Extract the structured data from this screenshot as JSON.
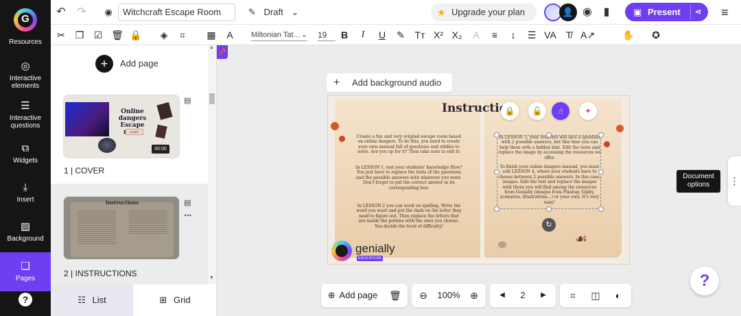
{
  "rail": {
    "logo_letter": "G",
    "items": [
      {
        "label": "Resources",
        "icon": "resources-icon"
      },
      {
        "label": "Interactive elements",
        "icon": "interactive-elements-icon"
      },
      {
        "label": "Interactive questions",
        "icon": "questions-icon"
      },
      {
        "label": "Widgets",
        "icon": "widgets-icon"
      },
      {
        "label": "Insert",
        "icon": "insert-icon"
      },
      {
        "label": "Background",
        "icon": "background-icon"
      },
      {
        "label": "Pages",
        "icon": "pages-icon"
      }
    ],
    "help": "?"
  },
  "topbar": {
    "title": "Witchcraft Escape Room",
    "status": "Draft",
    "upgrade_label": "Upgrade your plan",
    "present_label": "Present"
  },
  "format": {
    "font": "Miltonian Tat…",
    "size": "19",
    "bold": "B",
    "italic": "I",
    "underline": "U"
  },
  "pages": {
    "add_label": "Add page",
    "items": [
      {
        "number": "1",
        "name": "COVER",
        "thumb_title": "Online dangers Escape room",
        "thumb_button": "START",
        "thumb_timer": "00:00"
      },
      {
        "number": "2",
        "name": "INSTRUCTIONS",
        "thumb_title": "Instructions"
      }
    ],
    "view": {
      "list": "List",
      "grid": "Grid"
    }
  },
  "canvas": {
    "bg_audio_label": "Add background audio",
    "slide": {
      "title": "Instructio",
      "left_p1": "Create a fun and very original escape room based on online dangers. To do this, you need to create your own manual full of questions and riddles to solve. Are you up for it? Then take note to edit it:",
      "left_p2": "In LESSON 1, test your students' knowledge How? You just have to replace the texts of the questions and the possible answers with whatever you want. Don't forget to put the correct answer in its corresponding box.",
      "left_p3": "In LESSON 2 you can work on spelling. Write the word you want and put the dash on the letter they need to figure out. Then replace the letters that are inside the potions with the ones you choose. You decide the level of difficulty!",
      "right_p1": "In LESSON 3, your students will face a question with 2 possible answers, but this time you can help them with a hidden hint. Edit the texts and replace the image by accessing the resources we offer.",
      "right_p2": "To finish your online dangers manual, you must edit LESSON 4, where your students have to choose between 2 possible answers. In this case, images. Edit the text and replace the images with those you will find among the resources from Genially (images from Pixabay, Giphy, scenarios, illustrations...) or your own. It's very easy!",
      "brand_name": "genially",
      "brand_edition": "EDUCATION"
    }
  },
  "tooltip": {
    "document_options": "Document options"
  },
  "bottom": {
    "add_page": "Add page",
    "zoom": "100%",
    "page_number": "2"
  },
  "colors": {
    "accent": "#6e3ef1",
    "rail": "#151515",
    "upgrade_star": "#f4b400"
  }
}
